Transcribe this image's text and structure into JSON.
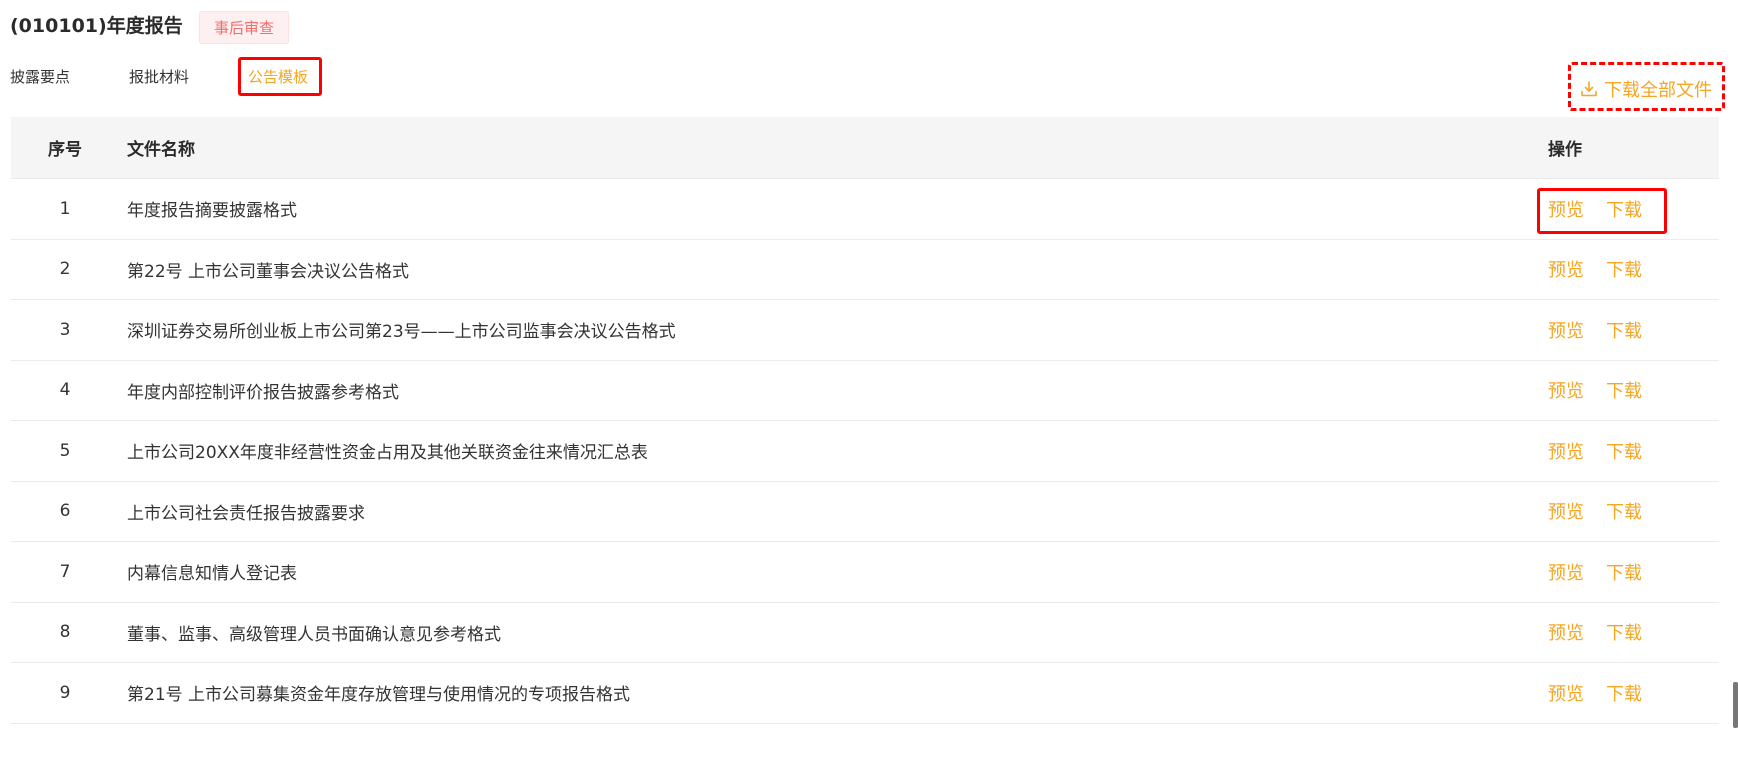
{
  "header": {
    "title": "(010101)年度报告",
    "badge": "事后审查"
  },
  "tabs": [
    {
      "label": "披露要点",
      "active": false
    },
    {
      "label": "报批材料",
      "active": false
    },
    {
      "label": "公告模板",
      "active": true
    }
  ],
  "actions": {
    "download_all_label": "下载全部文件",
    "download_icon": "download-icon"
  },
  "table": {
    "columns": {
      "index": "序号",
      "name": "文件名称",
      "operation": "操作"
    },
    "rows": [
      {
        "index": "1",
        "name": "年度报告摘要披露格式",
        "preview": "预览",
        "download": "下载"
      },
      {
        "index": "2",
        "name": "第22号 上市公司董事会决议公告格式",
        "preview": "预览",
        "download": "下载"
      },
      {
        "index": "3",
        "name": "深圳证券交易所创业板上市公司第23号——上市公司监事会决议公告格式",
        "preview": "预览",
        "download": "下载"
      },
      {
        "index": "4",
        "name": "年度内部控制评价报告披露参考格式",
        "preview": "预览",
        "download": "下载"
      },
      {
        "index": "5",
        "name": "上市公司20XX年度非经营性资金占用及其他关联资金往来情况汇总表",
        "preview": "预览",
        "download": "下载"
      },
      {
        "index": "6",
        "name": "上市公司社会责任报告披露要求",
        "preview": "预览",
        "download": "下载"
      },
      {
        "index": "7",
        "name": "内幕信息知情人登记表",
        "preview": "预览",
        "download": "下载"
      },
      {
        "index": "8",
        "name": "董事、监事、高级管理人员书面确认意见参考格式",
        "preview": "预览",
        "download": "下载"
      },
      {
        "index": "9",
        "name": "第21号 上市公司募集资金年度存放管理与使用情况的专项报告格式",
        "preview": "预览",
        "download": "下载"
      }
    ]
  },
  "colors": {
    "accent": "#f5a623",
    "badge_text": "#f56c6c",
    "badge_bg": "#fef0f0",
    "highlight": "#ff0000",
    "header_bg": "#f5f5f5"
  }
}
